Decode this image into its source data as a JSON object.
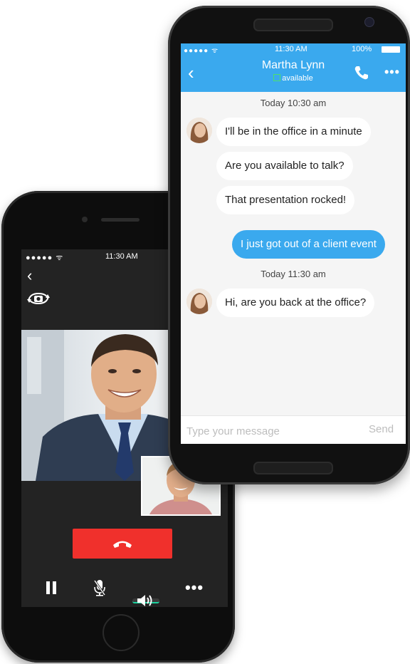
{
  "video_call": {
    "status": {
      "signal": "●●●●● ᯤ",
      "time": "11:30 AM"
    },
    "controls": {
      "more": "•••"
    }
  },
  "chat": {
    "status": {
      "signal": "●●●●● ᯤ",
      "time": "11:30 AM",
      "battery": "100%"
    },
    "contact": {
      "name": "Martha Lynn",
      "presence": "available"
    },
    "header_menu": "•••",
    "messages": [
      {
        "type": "timestamp",
        "text": "Today 10:30 am"
      },
      {
        "type": "incoming",
        "text": "I'll be in the office in a minute"
      },
      {
        "type": "incoming",
        "text": "Are you available to talk?"
      },
      {
        "type": "incoming",
        "text": "That presentation rocked!"
      },
      {
        "type": "outgoing",
        "text": "I just got out of a client event"
      },
      {
        "type": "timestamp",
        "text": "Today 11:30 am"
      },
      {
        "type": "incoming",
        "text": "Hi, are you back at the office?"
      }
    ],
    "composer": {
      "placeholder": "Type your message",
      "send_label": "Send"
    }
  },
  "colors": {
    "accent": "#3aa9ee",
    "end_call": "#f0302c",
    "presence": "#4be06b",
    "speaker_active": "#1bd3a0"
  }
}
